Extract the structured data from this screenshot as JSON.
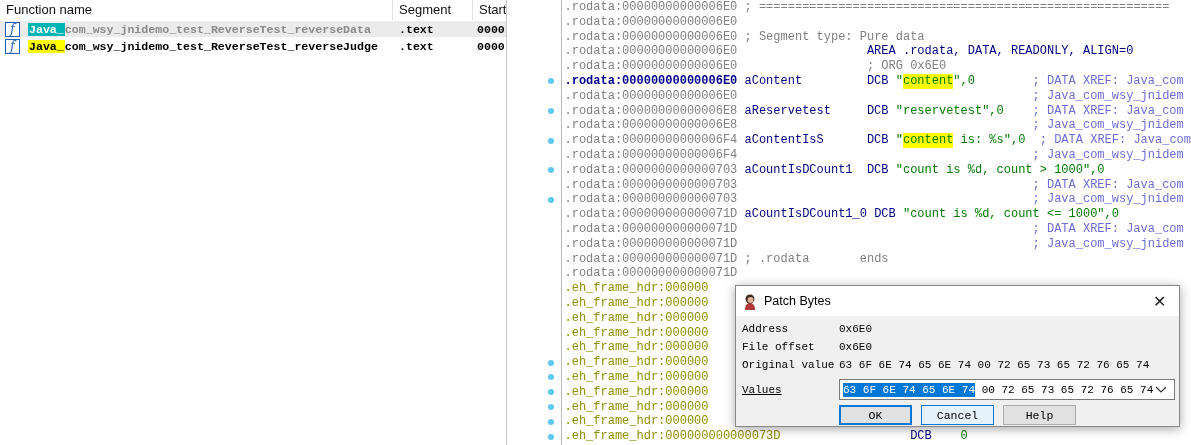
{
  "functions": {
    "columns": [
      "Function name",
      "Segment",
      "Start"
    ],
    "rows": [
      {
        "icon": "f",
        "prefix": "Java_",
        "name": "com_wsy_jnidemo_test_ReverseTest_reverseData",
        "segment": ".text",
        "start": "0000",
        "selected": true
      },
      {
        "icon": "f",
        "prefix": "Java_",
        "name": "com_wsy_jnidemo_test_ReverseTest_reverseJudge",
        "segment": ".text",
        "start": "0000",
        "selected": false
      }
    ]
  },
  "listing": {
    "lines": [
      {
        "kind": "rodata",
        "address": ".rodata:00000000000006E0",
        "current": false,
        "marked": false,
        "note": "; ========================================================="
      },
      {
        "kind": "rodata",
        "address": ".rodata:00000000000006E0",
        "current": false,
        "marked": false
      },
      {
        "kind": "rodata",
        "address": ".rodata:00000000000006E0",
        "current": false,
        "marked": false,
        "note": "; Segment type: Pure data"
      },
      {
        "kind": "rodata",
        "address": ".rodata:00000000000006E0",
        "current": false,
        "marked": false,
        "code": [
          {
            "text": "AREA .rodata, DATA, READONLY, ALIGN=0",
            "kind": "keyword",
            "highlight": false
          }
        ]
      },
      {
        "kind": "rodata",
        "address": ".rodata:00000000000006E0",
        "current": false,
        "marked": false,
        "code": [
          {
            "text": "; ORG 0x6E0",
            "kind": "comment",
            "highlight": false
          }
        ]
      },
      {
        "kind": "rodata",
        "address": ".rodata:00000000000006E0",
        "current": true,
        "marked": true,
        "label": "aContent",
        "code": [
          {
            "text": "DCB ",
            "kind": "keyword",
            "highlight": false
          },
          {
            "text": "\"",
            "kind": "string",
            "highlight": false
          },
          {
            "text": "content",
            "kind": "string",
            "highlight": true
          },
          {
            "text": "\",0",
            "kind": "string",
            "highlight": false
          }
        ],
        "comment": "; DATA XREF: Java_com"
      },
      {
        "kind": "rodata",
        "address": ".rodata:00000000000006E0",
        "current": false,
        "marked": false,
        "comment": "; Java_com_wsy_jnidem"
      },
      {
        "kind": "rodata",
        "address": ".rodata:00000000000006E8",
        "current": false,
        "marked": true,
        "label": "aReservetest",
        "code": [
          {
            "text": "DCB ",
            "kind": "keyword",
            "highlight": false
          },
          {
            "text": "\"reservetest\",0",
            "kind": "string",
            "highlight": false
          }
        ],
        "comment": "; DATA XREF: Java_com"
      },
      {
        "kind": "rodata",
        "address": ".rodata:00000000000006E8",
        "current": false,
        "marked": false,
        "comment": "; Java_com_wsy_jnidem"
      },
      {
        "kind": "rodata",
        "address": ".rodata:00000000000006F4",
        "current": false,
        "marked": true,
        "label": "aContentIsS",
        "code": [
          {
            "text": "DCB ",
            "kind": "keyword",
            "highlight": false
          },
          {
            "text": "\"",
            "kind": "string",
            "highlight": false
          },
          {
            "text": "content",
            "kind": "string",
            "highlight": true
          },
          {
            "text": " is: %s\",0",
            "kind": "string",
            "highlight": false
          }
        ],
        "comment": "; DATA XREF: Java_com"
      },
      {
        "kind": "rodata",
        "address": ".rodata:00000000000006F4",
        "current": false,
        "marked": false,
        "comment": "; Java_com_wsy_jnidem"
      },
      {
        "kind": "rodata",
        "address": ".rodata:0000000000000703",
        "current": false,
        "marked": true,
        "label": "aCountIsDCount1",
        "code": [
          {
            "text": "DCB ",
            "kind": "keyword",
            "highlight": false
          },
          {
            "text": "\"count is %d, count > 1000\",0",
            "kind": "string",
            "highlight": false
          }
        ]
      },
      {
        "kind": "rodata",
        "address": ".rodata:0000000000000703",
        "current": false,
        "marked": false,
        "comment": "; DATA XREF: Java_com"
      },
      {
        "kind": "rodata",
        "address": ".rodata:0000000000000703",
        "current": false,
        "marked": true,
        "comment": "; Java_com_wsy_jnidem"
      },
      {
        "kind": "rodata",
        "address": ".rodata:000000000000071D",
        "current": false,
        "marked": false,
        "label": "aCountIsDCount1_0",
        "code": [
          {
            "text": "DCB ",
            "kind": "keyword",
            "highlight": false
          },
          {
            "text": "\"count is %d, count <= 1000\",0",
            "kind": "string",
            "highlight": false
          }
        ]
      },
      {
        "kind": "rodata",
        "address": ".rodata:000000000000071D",
        "current": false,
        "marked": false,
        "comment": "; DATA XREF: Java_com"
      },
      {
        "kind": "rodata",
        "address": ".rodata:000000000000071D",
        "current": false,
        "marked": false,
        "comment": "; Java_com_wsy_jnidem"
      },
      {
        "kind": "rodata",
        "address": ".rodata:000000000000071D",
        "current": false,
        "marked": false,
        "note": "; .rodata       ends"
      },
      {
        "kind": "rodata",
        "address": ".rodata:000000000000071D",
        "current": false,
        "marked": false
      },
      {
        "kind": "eh",
        "address": ".eh_frame_hdr:000000",
        "current": false,
        "marked": false
      },
      {
        "kind": "eh",
        "address": ".eh_frame_hdr:000000",
        "current": false,
        "marked": false
      },
      {
        "kind": "eh",
        "address": ".eh_frame_hdr:000000",
        "current": false,
        "marked": false
      },
      {
        "kind": "eh",
        "address": ".eh_frame_hdr:000000",
        "current": false,
        "marked": false
      },
      {
        "kind": "eh",
        "address": ".eh_frame_hdr:000000",
        "current": false,
        "marked": false
      },
      {
        "kind": "eh",
        "address": ".eh_frame_hdr:000000",
        "current": false,
        "marked": true
      },
      {
        "kind": "eh",
        "address": ".eh_frame_hdr:000000",
        "current": false,
        "marked": true
      },
      {
        "kind": "eh",
        "address": ".eh_frame_hdr:000000",
        "current": false,
        "marked": true
      },
      {
        "kind": "eh",
        "address": ".eh_frame_hdr:000000",
        "current": false,
        "marked": true
      },
      {
        "kind": "eh",
        "address": ".eh_frame_hdr:000000",
        "current": false,
        "marked": true
      },
      {
        "kind": "eh",
        "address": ".eh_frame_hdr:000000000000073D",
        "current": false,
        "marked": true,
        "code": [
          {
            "text": "DCB ",
            "kind": "keyword",
            "highlight": false
          },
          {
            "text": "   0",
            "kind": "string",
            "highlight": false
          }
        ]
      }
    ]
  },
  "dialog": {
    "title": "Patch Bytes",
    "close": "✕",
    "fields": [
      {
        "label": "Address",
        "value": "0x6E0"
      },
      {
        "label": "File offset",
        "value": "0x6E0"
      },
      {
        "label": "Original value",
        "value": "63 6F 6E 74 65 6E 74 00 72 65 73 65 72 76 65 74"
      }
    ],
    "values": {
      "label": "Values",
      "parts": [
        {
          "text": "63 6F 6E 74 65 6E 74",
          "selected": true
        },
        {
          "text": " 00 72 65 73 65 72 76 65 74",
          "selected": false
        }
      ]
    },
    "buttons": [
      {
        "label": "OK",
        "focused": true,
        "hot": false
      },
      {
        "label": "Cancel",
        "focused": false,
        "hot": true
      },
      {
        "label": "Help",
        "focused": false,
        "hot": false
      }
    ]
  }
}
